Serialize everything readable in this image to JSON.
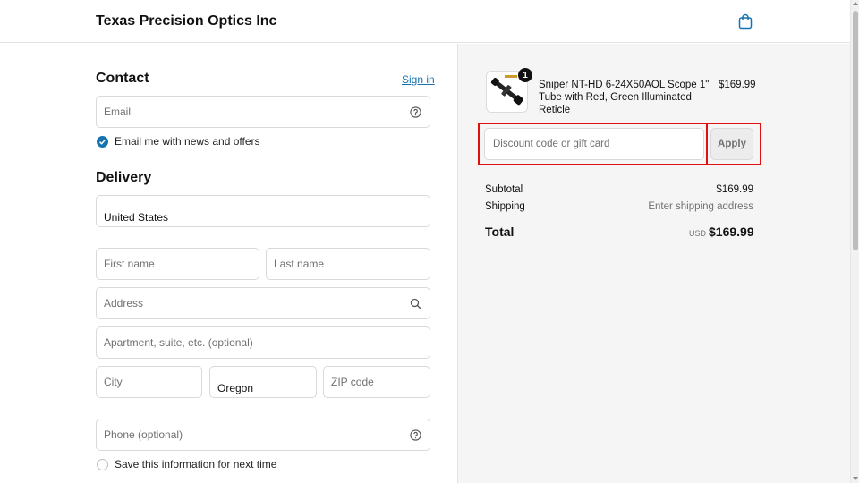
{
  "header": {
    "store_name": "Texas Precision Optics Inc",
    "cart_icon": "shopping-bag-icon"
  },
  "contact": {
    "title": "Contact",
    "sign_in": "Sign in",
    "email_placeholder": "Email",
    "newsletter_label": "Email me with news and offers",
    "newsletter_checked": true
  },
  "delivery": {
    "title": "Delivery",
    "country": "United States",
    "first_name_placeholder": "First name",
    "last_name_placeholder": "Last name",
    "address_placeholder": "Address",
    "apartment_placeholder": "Apartment, suite, etc. (optional)",
    "city_placeholder": "City",
    "state": "Oregon",
    "zip_placeholder": "ZIP code",
    "phone_placeholder": "Phone (optional)",
    "save_info_label": "Save this information for next time",
    "save_info_checked": false
  },
  "summary": {
    "product": {
      "name": "Sniper NT-HD 6-24X50AOL Scope 1\" Tube with Red, Green Illuminated Reticle",
      "price": "$169.99",
      "quantity": "1"
    },
    "discount": {
      "placeholder": "Discount code or gift card",
      "apply_label": "Apply"
    },
    "subtotal_label": "Subtotal",
    "subtotal_value": "$169.99",
    "shipping_label": "Shipping",
    "shipping_value": "Enter shipping address",
    "total_label": "Total",
    "currency": "USD",
    "total_value": "$169.99"
  },
  "colors": {
    "accent": "#1773b0",
    "highlight": "#e01010",
    "panel_bg": "#f5f5f5"
  }
}
